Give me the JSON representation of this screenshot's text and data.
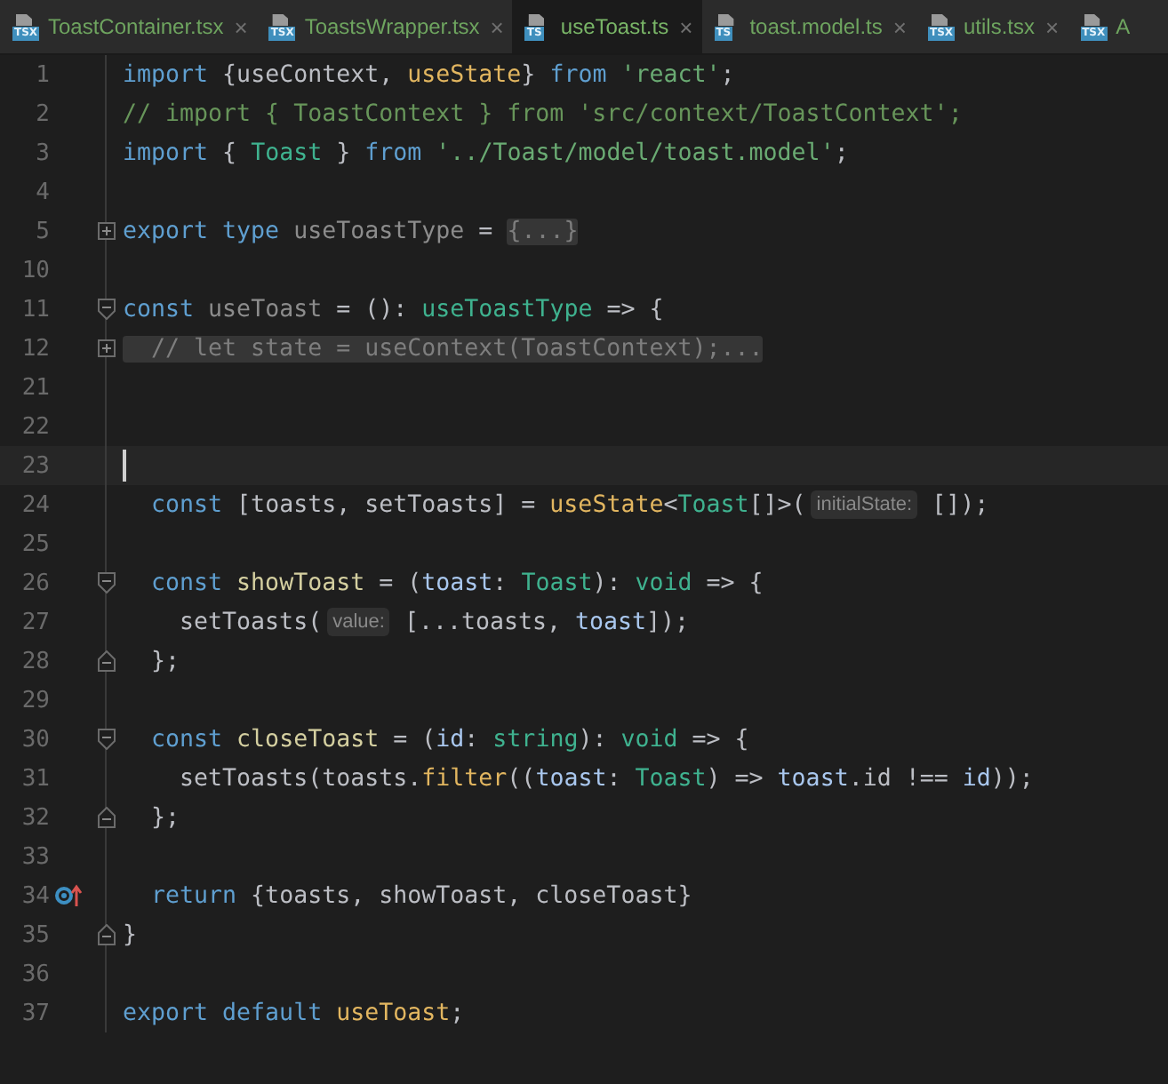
{
  "tabs": [
    {
      "icon_label": "TSX",
      "name": "ToastContainer.tsx",
      "close": "×",
      "selected": false
    },
    {
      "icon_label": "TSX",
      "name": "ToastsWrapper.tsx",
      "close": "×",
      "selected": false
    },
    {
      "icon_label": "TS",
      "name": "useToast.ts",
      "close": "×",
      "selected": true
    },
    {
      "icon_label": "TS",
      "name": "toast.model.ts",
      "close": "×",
      "selected": false
    },
    {
      "icon_label": "TSX",
      "name": "utils.tsx",
      "close": "×",
      "selected": false
    },
    {
      "icon_label": "TSX",
      "name": "A",
      "selected": false
    }
  ],
  "lines": [
    {
      "number": "1",
      "tokens": [
        {
          "kind": "keyword",
          "text": "import"
        },
        {
          "kind": "plain",
          "text": " {useContext, "
        },
        {
          "kind": "func",
          "text": "useState"
        },
        {
          "kind": "plain",
          "text": "} "
        },
        {
          "kind": "keyword",
          "text": "from "
        },
        {
          "kind": "string",
          "text": "'react'"
        },
        {
          "kind": "plain",
          "text": ";"
        }
      ]
    },
    {
      "number": "2",
      "tokens": [
        {
          "kind": "comment",
          "text": "// import { ToastContext } from 'src/context/ToastContext';"
        }
      ]
    },
    {
      "number": "3",
      "tokens": [
        {
          "kind": "keyword",
          "text": "import"
        },
        {
          "kind": "plain",
          "text": " { "
        },
        {
          "kind": "type",
          "text": "Toast"
        },
        {
          "kind": "plain",
          "text": " } "
        },
        {
          "kind": "keyword",
          "text": "from "
        },
        {
          "kind": "string",
          "text": "'../Toast/model/toast.model'"
        },
        {
          "kind": "plain",
          "text": ";"
        }
      ]
    },
    {
      "number": "4"
    },
    {
      "number": "5",
      "collapsed": true,
      "tokens": [
        {
          "kind": "keyword",
          "text": "export type "
        },
        {
          "kind": "dim",
          "text": "useToastType"
        },
        {
          "kind": "plain",
          "text": " = "
        },
        {
          "kind": "folded",
          "text": "{...}"
        }
      ]
    },
    {
      "number": "10"
    },
    {
      "number": "11",
      "fold_start": true,
      "tokens": [
        {
          "kind": "keyword",
          "text": "const "
        },
        {
          "kind": "dim",
          "text": "useToast"
        },
        {
          "kind": "plain",
          "text": " = (): "
        },
        {
          "kind": "type",
          "text": "useToastType"
        },
        {
          "kind": "plain",
          "text": " => {"
        }
      ]
    },
    {
      "number": "12",
      "collapsed": true,
      "tokens": [
        {
          "kind": "folded",
          "text": "  // let state = useContext(ToastContext);..."
        }
      ]
    },
    {
      "number": "21"
    },
    {
      "number": "22"
    },
    {
      "number": "23",
      "current": true
    },
    {
      "number": "24",
      "tokens": [
        {
          "kind": "keyword",
          "text": "  const"
        },
        {
          "kind": "plain",
          "text": " [toasts, setToasts] = "
        },
        {
          "kind": "func",
          "text": "useState"
        },
        {
          "kind": "plain",
          "text": "<"
        },
        {
          "kind": "type",
          "text": "Toast"
        },
        {
          "kind": "plain",
          "text": "[]>("
        },
        {
          "kind": "hint",
          "text": "initialState:"
        },
        {
          "kind": "plain",
          "text": " []);"
        }
      ]
    },
    {
      "number": "25"
    },
    {
      "number": "26",
      "fold_start": true,
      "tokens": [
        {
          "kind": "keyword",
          "text": "  const "
        },
        {
          "kind": "var",
          "text": "showToast"
        },
        {
          "kind": "plain",
          "text": " = ("
        },
        {
          "kind": "param",
          "text": "toast"
        },
        {
          "kind": "plain",
          "text": ": "
        },
        {
          "kind": "type",
          "text": "Toast"
        },
        {
          "kind": "plain",
          "text": "): "
        },
        {
          "kind": "type",
          "text": "void"
        },
        {
          "kind": "plain",
          "text": " => {"
        }
      ]
    },
    {
      "number": "27",
      "tokens": [
        {
          "kind": "plain",
          "text": "    setToasts("
        },
        {
          "kind": "hint",
          "text": "value:"
        },
        {
          "kind": "plain",
          "text": " [...toasts, "
        },
        {
          "kind": "param",
          "text": "toast"
        },
        {
          "kind": "plain",
          "text": "]);"
        }
      ]
    },
    {
      "number": "28",
      "fold_end": true,
      "tokens": [
        {
          "kind": "plain",
          "text": "  };"
        }
      ]
    },
    {
      "number": "29"
    },
    {
      "number": "30",
      "fold_start": true,
      "tokens": [
        {
          "kind": "keyword",
          "text": "  const "
        },
        {
          "kind": "var",
          "text": "closeToast"
        },
        {
          "kind": "plain",
          "text": " = ("
        },
        {
          "kind": "param",
          "text": "id"
        },
        {
          "kind": "plain",
          "text": ": "
        },
        {
          "kind": "type",
          "text": "string"
        },
        {
          "kind": "plain",
          "text": "): "
        },
        {
          "kind": "type",
          "text": "void"
        },
        {
          "kind": "plain",
          "text": " => {"
        }
      ]
    },
    {
      "number": "31",
      "tokens": [
        {
          "kind": "plain",
          "text": "    setToasts(toasts."
        },
        {
          "kind": "func",
          "text": "filter"
        },
        {
          "kind": "plain",
          "text": "(("
        },
        {
          "kind": "param",
          "text": "toast"
        },
        {
          "kind": "plain",
          "text": ": "
        },
        {
          "kind": "type",
          "text": "Toast"
        },
        {
          "kind": "plain",
          "text": ") => "
        },
        {
          "kind": "param",
          "text": "toast"
        },
        {
          "kind": "plain",
          "text": ".id !== "
        },
        {
          "kind": "param",
          "text": "id"
        },
        {
          "kind": "plain",
          "text": "));"
        }
      ]
    },
    {
      "number": "32",
      "fold_end": true,
      "tokens": [
        {
          "kind": "plain",
          "text": "  };"
        }
      ]
    },
    {
      "number": "33"
    },
    {
      "number": "34",
      "marked": true,
      "tokens": [
        {
          "kind": "keyword",
          "text": "  return"
        },
        {
          "kind": "plain",
          "text": " {toasts, showToast, closeToast}"
        }
      ]
    },
    {
      "number": "35",
      "fold_end": true,
      "tokens": [
        {
          "kind": "plain",
          "text": "}"
        }
      ]
    },
    {
      "number": "36"
    },
    {
      "number": "37",
      "tokens": [
        {
          "kind": "keyword",
          "text": "export default "
        },
        {
          "kind": "func",
          "text": "useToast"
        },
        {
          "kind": "plain",
          "text": ";"
        }
      ]
    }
  ]
}
